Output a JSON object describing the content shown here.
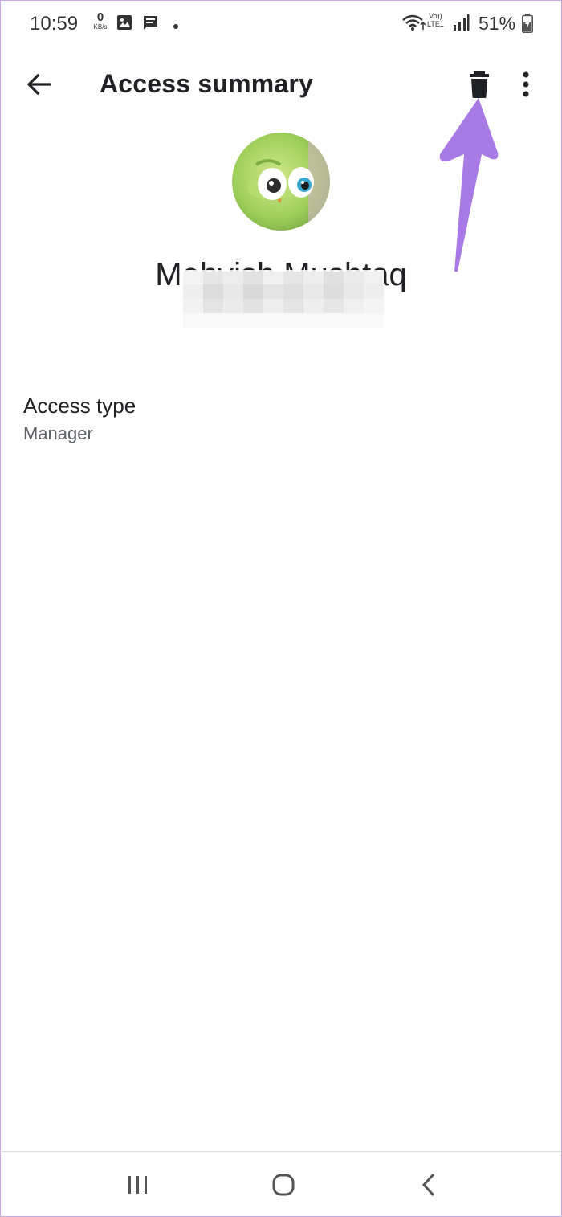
{
  "status_bar": {
    "time": "10:59",
    "net_speed_value": "0",
    "net_speed_unit": "KB/s",
    "volte_top": "Vo))",
    "volte_bottom": "LTE1",
    "battery_percent": "51%",
    "icons": [
      "image-icon",
      "message-icon",
      "dot-icon",
      "wifi-icon",
      "signal-icon",
      "battery-charging-icon"
    ]
  },
  "app_bar": {
    "title": "Access summary",
    "back_icon": "arrow-back-icon",
    "delete_icon": "trash-icon",
    "more_icon": "more-vert-icon"
  },
  "profile": {
    "name": "Mehvish Mushtaq"
  },
  "access": {
    "label": "Access type",
    "value": "Manager"
  },
  "annotation": {
    "color": "#a77ae6"
  },
  "nav_bar": {
    "icons": [
      "recent-apps-icon",
      "home-icon",
      "nav-back-icon"
    ]
  }
}
